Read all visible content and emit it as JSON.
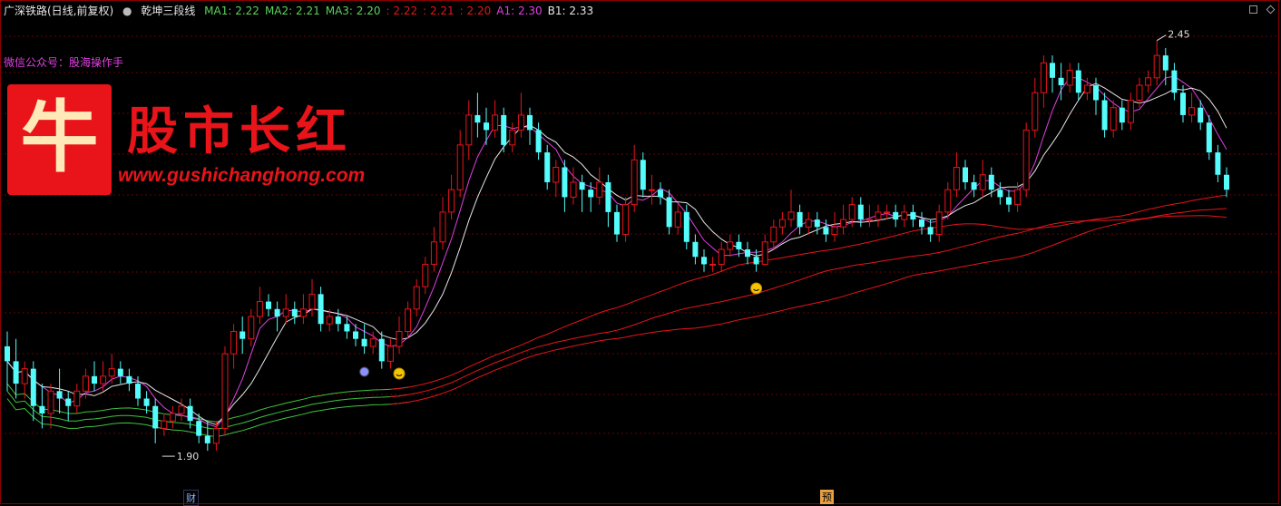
{
  "header": {
    "title": "广深铁路(日线,前复权)",
    "indicator_name": "乾坤三段线",
    "items": [
      {
        "label": "MA1: 2.22",
        "color": "#5ad35a"
      },
      {
        "label": "MA2: 2.21",
        "color": "#5ad35a"
      },
      {
        "label": "MA3: 2.20",
        "color": "#5ad35a"
      },
      {
        "label": ": 2.22",
        "color": "#e8141a"
      },
      {
        "label": ": 2.21",
        "color": "#e8141a"
      },
      {
        "label": ": 2.20",
        "color": "#e8141a"
      },
      {
        "label": "A1: 2.30",
        "color": "#e040e0"
      },
      {
        "label": "B1: 2.33",
        "color": "#e6e6e6"
      }
    ]
  },
  "watermark": {
    "wechat": "微信公众号：股海操作手",
    "logo_char": "牛",
    "brand": "股市长红",
    "url": "www.gushichanghong.com"
  },
  "markers": {
    "high_label": "2.45",
    "low_label": "1.90",
    "bottom_tag_1": "财",
    "bottom_tag_2": "预"
  },
  "colors": {
    "up": "#e8141a",
    "down": "#54fcfc",
    "ma_green": "#3ec43e",
    "ma_red": "#e8141a",
    "a1": "#e040e0",
    "b1": "#e6e6e6",
    "grid": "#6a0000"
  },
  "chart_data": {
    "type": "candlestick",
    "ylim": [
      1.86,
      2.48
    ],
    "grid": true,
    "candles": [
      [
        2.04,
        2.02,
        2.06,
        1.98
      ],
      [
        2.02,
        1.99,
        2.05,
        1.97
      ],
      [
        1.99,
        2.01,
        2.02,
        1.97
      ],
      [
        2.01,
        1.96,
        2.02,
        1.94
      ],
      [
        1.96,
        1.95,
        1.99,
        1.93
      ],
      [
        1.95,
        1.98,
        1.99,
        1.93
      ],
      [
        1.98,
        1.97,
        2.01,
        1.95
      ],
      [
        1.97,
        1.96,
        1.98,
        1.94
      ],
      [
        1.96,
        1.98,
        1.99,
        1.95
      ],
      [
        1.98,
        2.0,
        2.01,
        1.97
      ],
      [
        2.0,
        1.99,
        2.02,
        1.98
      ],
      [
        1.99,
        2.0,
        2.02,
        1.98
      ],
      [
        2.0,
        2.01,
        2.03,
        1.99
      ],
      [
        2.01,
        2.0,
        2.02,
        1.99
      ],
      [
        2.0,
        1.99,
        2.01,
        1.98
      ],
      [
        1.99,
        1.97,
        2.0,
        1.96
      ],
      [
        1.97,
        1.96,
        1.98,
        1.95
      ],
      [
        1.96,
        1.93,
        1.97,
        1.91
      ],
      [
        1.93,
        1.94,
        1.95,
        1.92
      ],
      [
        1.94,
        1.95,
        1.96,
        1.93
      ],
      [
        1.95,
        1.96,
        1.97,
        1.94
      ],
      [
        1.96,
        1.94,
        1.97,
        1.93
      ],
      [
        1.94,
        1.92,
        1.95,
        1.91
      ],
      [
        1.92,
        1.91,
        1.94,
        1.9
      ],
      [
        1.91,
        1.93,
        1.94,
        1.9
      ],
      [
        1.93,
        2.03,
        2.04,
        1.92
      ],
      [
        2.03,
        2.06,
        2.07,
        2.01
      ],
      [
        2.06,
        2.05,
        2.08,
        2.03
      ],
      [
        2.05,
        2.08,
        2.09,
        2.04
      ],
      [
        2.08,
        2.1,
        2.12,
        2.07
      ],
      [
        2.1,
        2.09,
        2.11,
        2.08
      ],
      [
        2.09,
        2.08,
        2.1,
        2.06
      ],
      [
        2.08,
        2.09,
        2.11,
        2.07
      ],
      [
        2.09,
        2.08,
        2.1,
        2.07
      ],
      [
        2.08,
        2.09,
        2.11,
        2.07
      ],
      [
        2.09,
        2.11,
        2.13,
        2.08
      ],
      [
        2.11,
        2.07,
        2.12,
        2.06
      ],
      [
        2.07,
        2.08,
        2.09,
        2.06
      ],
      [
        2.08,
        2.07,
        2.09,
        2.06
      ],
      [
        2.07,
        2.06,
        2.08,
        2.05
      ],
      [
        2.06,
        2.05,
        2.07,
        2.04
      ],
      [
        2.05,
        2.04,
        2.07,
        2.03
      ],
      [
        2.04,
        2.05,
        2.06,
        2.03
      ],
      [
        2.05,
        2.02,
        2.06,
        2.01
      ],
      [
        2.02,
        2.04,
        2.05,
        2.01
      ],
      [
        2.04,
        2.06,
        2.08,
        2.03
      ],
      [
        2.06,
        2.09,
        2.1,
        2.05
      ],
      [
        2.09,
        2.12,
        2.13,
        2.08
      ],
      [
        2.12,
        2.15,
        2.16,
        2.11
      ],
      [
        2.15,
        2.18,
        2.2,
        2.14
      ],
      [
        2.18,
        2.22,
        2.24,
        2.17
      ],
      [
        2.22,
        2.25,
        2.27,
        2.21
      ],
      [
        2.25,
        2.31,
        2.33,
        2.24
      ],
      [
        2.31,
        2.35,
        2.37,
        2.29
      ],
      [
        2.35,
        2.34,
        2.38,
        2.32
      ],
      [
        2.34,
        2.33,
        2.36,
        2.31
      ],
      [
        2.33,
        2.35,
        2.37,
        2.32
      ],
      [
        2.35,
        2.31,
        2.36,
        2.3
      ],
      [
        2.31,
        2.33,
        2.34,
        2.3
      ],
      [
        2.33,
        2.35,
        2.38,
        2.32
      ],
      [
        2.35,
        2.33,
        2.36,
        2.31
      ],
      [
        2.33,
        2.3,
        2.34,
        2.29
      ],
      [
        2.3,
        2.26,
        2.31,
        2.25
      ],
      [
        2.26,
        2.28,
        2.29,
        2.24
      ],
      [
        2.28,
        2.24,
        2.29,
        2.22
      ],
      [
        2.24,
        2.26,
        2.28,
        2.23
      ],
      [
        2.26,
        2.25,
        2.27,
        2.22
      ],
      [
        2.25,
        2.24,
        2.26,
        2.22
      ],
      [
        2.24,
        2.26,
        2.28,
        2.23
      ],
      [
        2.26,
        2.22,
        2.27,
        2.2
      ],
      [
        2.22,
        2.19,
        2.23,
        2.18
      ],
      [
        2.19,
        2.23,
        2.24,
        2.18
      ],
      [
        2.23,
        2.29,
        2.31,
        2.22
      ],
      [
        2.29,
        2.25,
        2.3,
        2.24
      ],
      [
        2.25,
        2.25,
        2.27,
        2.23
      ],
      [
        2.25,
        2.24,
        2.26,
        2.23
      ],
      [
        2.24,
        2.2,
        2.25,
        2.19
      ],
      [
        2.2,
        2.22,
        2.23,
        2.19
      ],
      [
        2.22,
        2.18,
        2.23,
        2.17
      ],
      [
        2.18,
        2.16,
        2.19,
        2.15
      ],
      [
        2.16,
        2.15,
        2.17,
        2.14
      ],
      [
        2.15,
        2.15,
        2.16,
        2.14
      ],
      [
        2.15,
        2.17,
        2.18,
        2.14
      ],
      [
        2.17,
        2.18,
        2.19,
        2.16
      ],
      [
        2.18,
        2.17,
        2.19,
        2.16
      ],
      [
        2.17,
        2.16,
        2.18,
        2.15
      ],
      [
        2.16,
        2.15,
        2.17,
        2.14
      ],
      [
        2.15,
        2.18,
        2.19,
        2.15
      ],
      [
        2.18,
        2.2,
        2.21,
        2.17
      ],
      [
        2.2,
        2.21,
        2.22,
        2.19
      ],
      [
        2.21,
        2.22,
        2.25,
        2.2
      ],
      [
        2.22,
        2.2,
        2.23,
        2.19
      ],
      [
        2.2,
        2.21,
        2.22,
        2.19
      ],
      [
        2.21,
        2.2,
        2.22,
        2.19
      ],
      [
        2.2,
        2.19,
        2.21,
        2.18
      ],
      [
        2.19,
        2.2,
        2.22,
        2.18
      ],
      [
        2.2,
        2.21,
        2.23,
        2.19
      ],
      [
        2.21,
        2.23,
        2.24,
        2.2
      ],
      [
        2.23,
        2.21,
        2.24,
        2.2
      ],
      [
        2.21,
        2.21,
        2.23,
        2.2
      ],
      [
        2.21,
        2.22,
        2.23,
        2.2
      ],
      [
        2.22,
        2.22,
        2.23,
        2.21
      ],
      [
        2.22,
        2.21,
        2.23,
        2.2
      ],
      [
        2.21,
        2.22,
        2.23,
        2.2
      ],
      [
        2.22,
        2.21,
        2.23,
        2.2
      ],
      [
        2.21,
        2.2,
        2.22,
        2.19
      ],
      [
        2.2,
        2.19,
        2.21,
        2.18
      ],
      [
        2.19,
        2.22,
        2.23,
        2.18
      ],
      [
        2.22,
        2.25,
        2.26,
        2.21
      ],
      [
        2.25,
        2.28,
        2.3,
        2.24
      ],
      [
        2.28,
        2.26,
        2.29,
        2.25
      ],
      [
        2.26,
        2.25,
        2.27,
        2.24
      ],
      [
        2.25,
        2.27,
        2.29,
        2.24
      ],
      [
        2.27,
        2.25,
        2.28,
        2.24
      ],
      [
        2.25,
        2.24,
        2.26,
        2.23
      ],
      [
        2.24,
        2.23,
        2.25,
        2.22
      ],
      [
        2.23,
        2.25,
        2.26,
        2.22
      ],
      [
        2.25,
        2.33,
        2.34,
        2.24
      ],
      [
        2.33,
        2.38,
        2.4,
        2.32
      ],
      [
        2.38,
        2.42,
        2.43,
        2.36
      ],
      [
        2.42,
        2.4,
        2.43,
        2.38
      ],
      [
        2.4,
        2.39,
        2.42,
        2.37
      ],
      [
        2.39,
        2.41,
        2.42,
        2.38
      ],
      [
        2.41,
        2.38,
        2.42,
        2.37
      ],
      [
        2.38,
        2.39,
        2.4,
        2.37
      ],
      [
        2.39,
        2.37,
        2.4,
        2.35
      ],
      [
        2.37,
        2.33,
        2.38,
        2.32
      ],
      [
        2.33,
        2.36,
        2.37,
        2.32
      ],
      [
        2.36,
        2.34,
        2.37,
        2.33
      ],
      [
        2.34,
        2.37,
        2.38,
        2.33
      ],
      [
        2.37,
        2.39,
        2.4,
        2.36
      ],
      [
        2.39,
        2.4,
        2.41,
        2.38
      ],
      [
        2.4,
        2.43,
        2.45,
        2.39
      ],
      [
        2.43,
        2.41,
        2.44,
        2.39
      ],
      [
        2.41,
        2.38,
        2.42,
        2.37
      ],
      [
        2.38,
        2.35,
        2.39,
        2.34
      ],
      [
        2.35,
        2.36,
        2.38,
        2.34
      ],
      [
        2.36,
        2.34,
        2.37,
        2.33
      ],
      [
        2.34,
        2.3,
        2.35,
        2.29
      ],
      [
        2.3,
        2.27,
        2.31,
        2.26
      ],
      [
        2.27,
        2.25,
        2.28,
        2.24
      ]
    ]
  }
}
